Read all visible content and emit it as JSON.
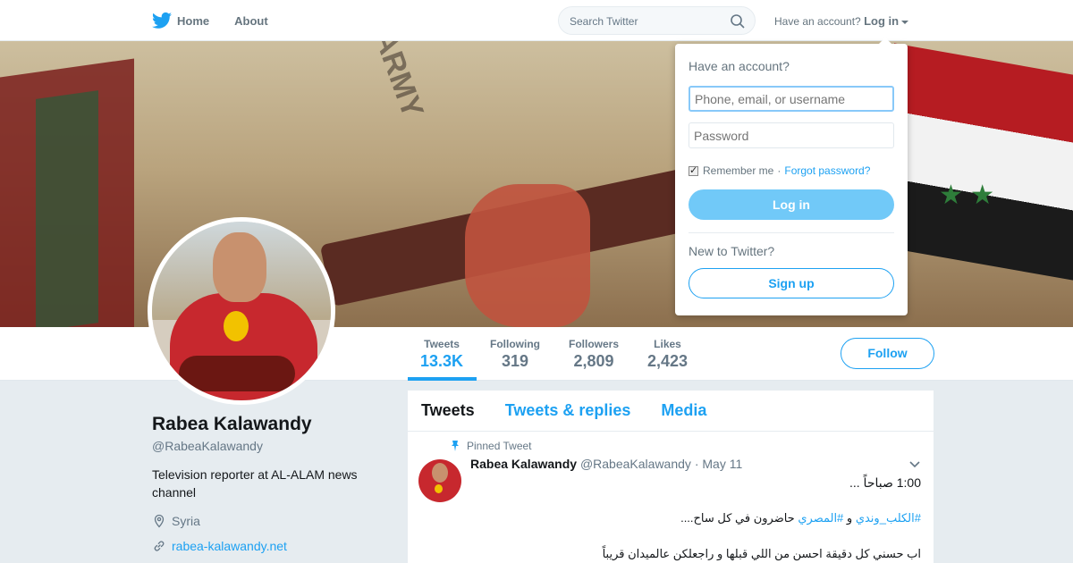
{
  "nav": {
    "home": "Home",
    "about": "About"
  },
  "search": {
    "placeholder": "Search Twitter"
  },
  "login_prompt": {
    "text": "Have an account?",
    "link": "Log in"
  },
  "profile": {
    "name": "Rabea Kalawandy",
    "handle": "@RabeaKalawandy",
    "bio": "Television reporter at AL-ALAM news channel",
    "location": "Syria",
    "url": "rabea-kalawandy.net"
  },
  "stats": [
    {
      "label": "Tweets",
      "value": "13.3K"
    },
    {
      "label": "Following",
      "value": "319"
    },
    {
      "label": "Followers",
      "value": "2,809"
    },
    {
      "label": "Likes",
      "value": "2,423"
    }
  ],
  "follow_button": "Follow",
  "timeline": {
    "tabs": [
      "Tweets",
      "Tweets & replies",
      "Media"
    ],
    "tweet": {
      "pinned_label": "Pinned Tweet",
      "author": "Rabea Kalawandy",
      "handle": "@RabeaKalawandy",
      "date": "· May 11",
      "line1": "1:00 صباحاً ...",
      "line2_tag1": "#الكلب_وندي",
      "line2_mid": " و ",
      "line2_tag2": "#المصري",
      "line2_rest": " حاضرون في كل ساح....",
      "line3": "اب حسني كل دقيقة احسن من اللي قبلها و راجعلكن عالميدان قريباً"
    }
  },
  "login_dropdown": {
    "title": "Have an account?",
    "username_placeholder": "Phone, email, or username",
    "password_placeholder": "Password",
    "remember": "Remember me",
    "forgot": "Forgot password?",
    "login": "Log in",
    "new": "New to Twitter?",
    "signup": "Sign up"
  },
  "colors": {
    "accent": "#1da1f2",
    "background": "#e6ecf0"
  }
}
